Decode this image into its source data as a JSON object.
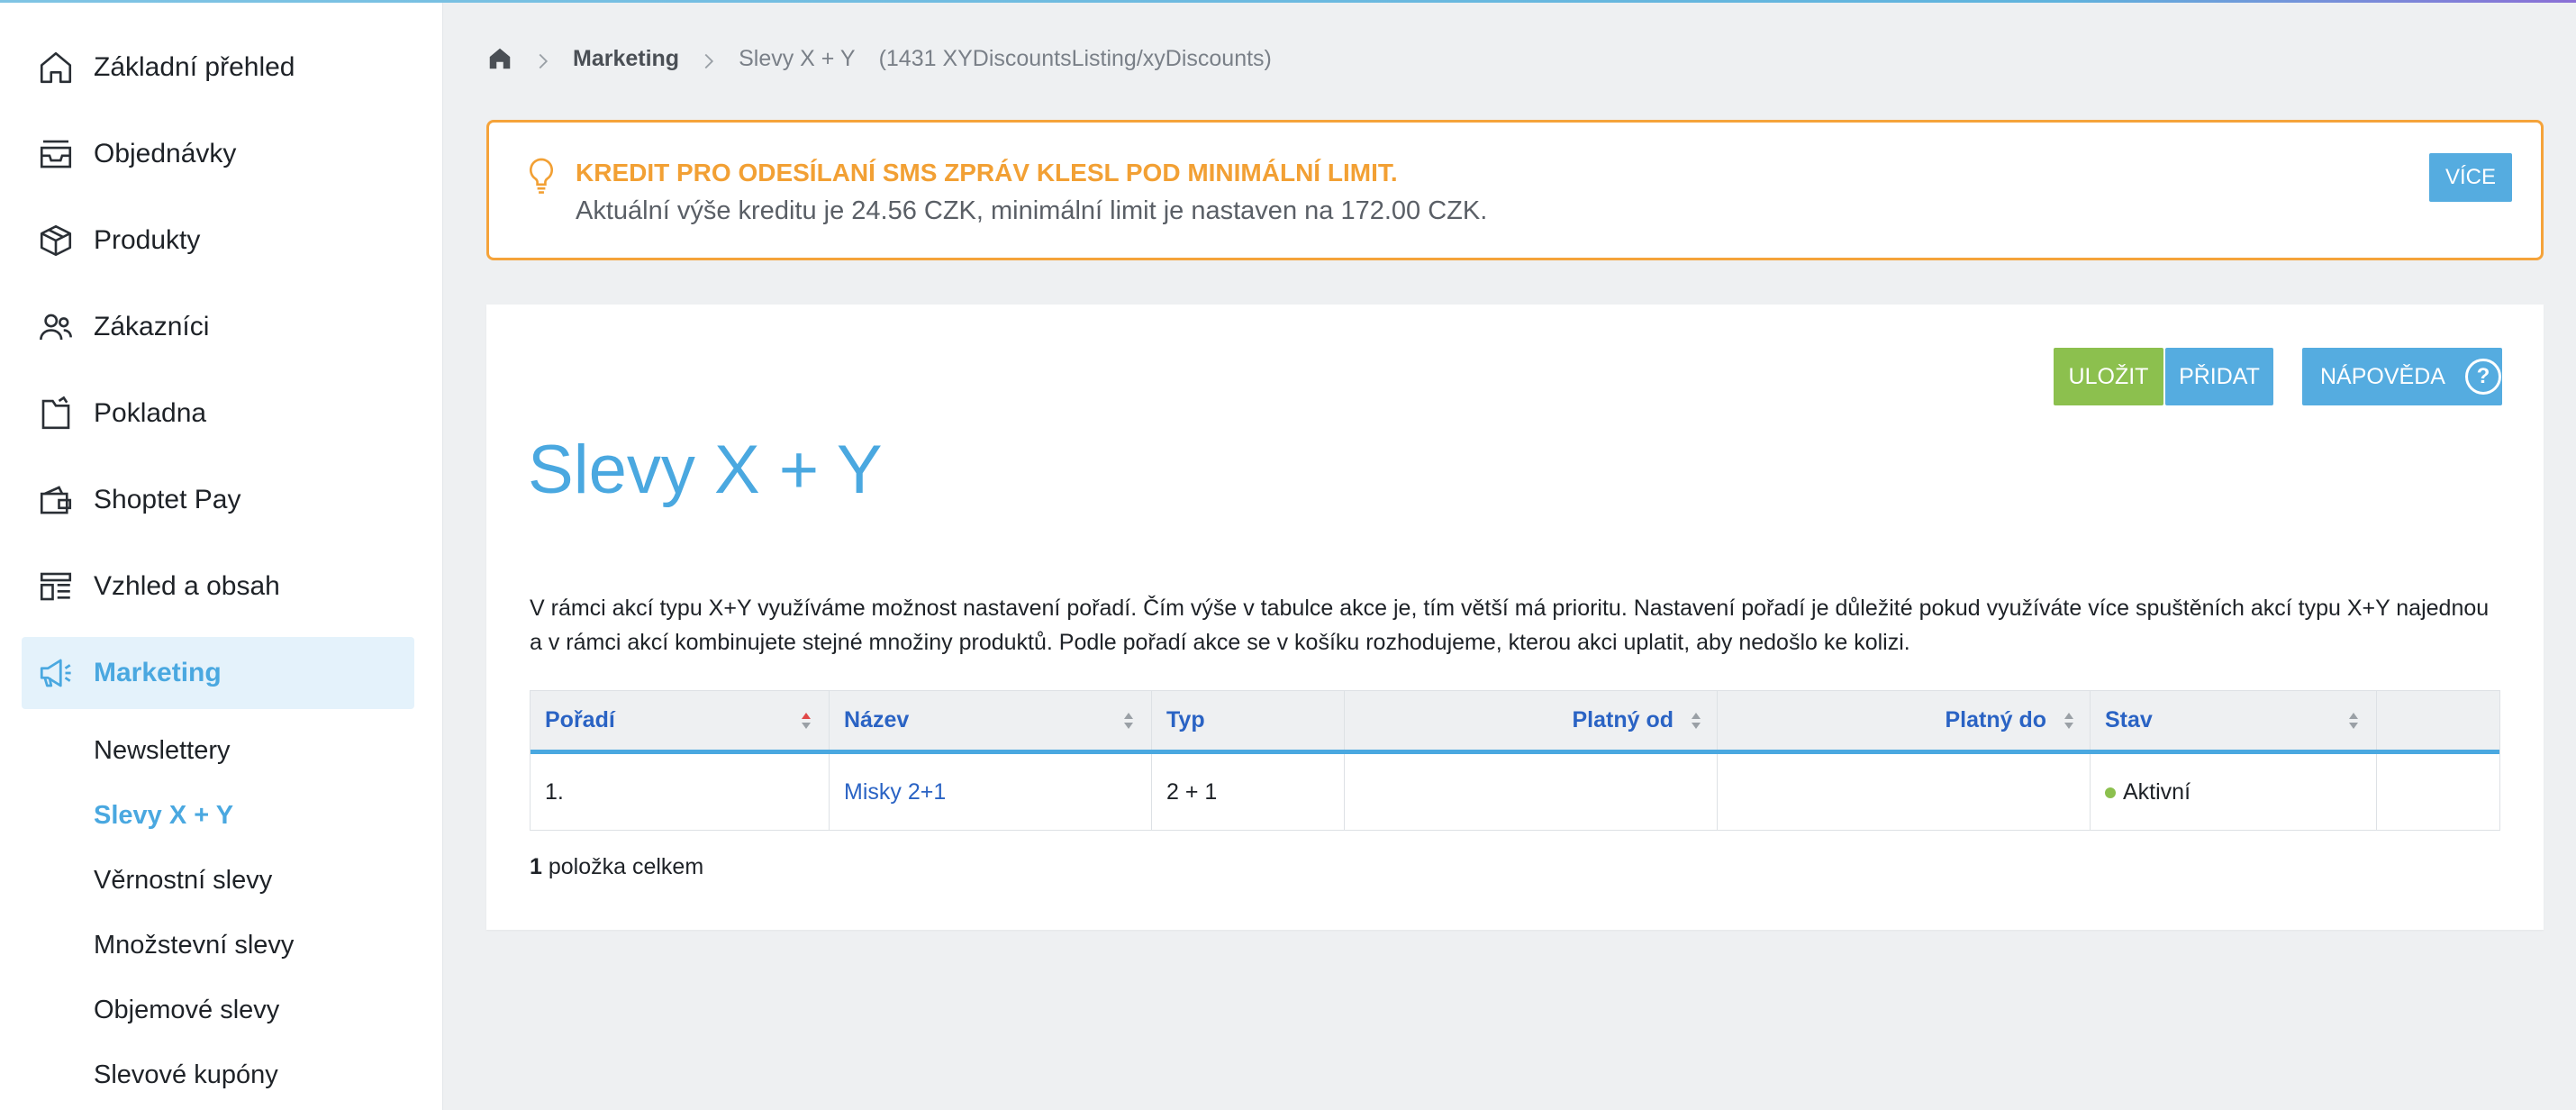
{
  "colors": {
    "accent": "#4aa8e0",
    "warning": "#f5a33a",
    "save_green": "#8cc04e",
    "link_blue": "#2a63c4"
  },
  "sidebar": {
    "items": [
      {
        "label": "Základní přehled",
        "icon": "home-icon"
      },
      {
        "label": "Objednávky",
        "icon": "inbox-icon"
      },
      {
        "label": "Produkty",
        "icon": "box-icon"
      },
      {
        "label": "Zákazníci",
        "icon": "users-icon"
      },
      {
        "label": "Pokladna",
        "icon": "cash-register-icon"
      },
      {
        "label": "Shoptet Pay",
        "icon": "wallet-icon"
      },
      {
        "label": "Vzhled a obsah",
        "icon": "layout-icon"
      },
      {
        "label": "Marketing",
        "icon": "megaphone-icon",
        "active": true
      }
    ],
    "subitems": [
      {
        "label": "Newslettery"
      },
      {
        "label": "Slevy X + Y",
        "active": true
      },
      {
        "label": "Věrnostní slevy"
      },
      {
        "label": "Množstevní slevy"
      },
      {
        "label": "Objemové slevy"
      },
      {
        "label": "Slevové kupóny"
      }
    ]
  },
  "breadcrumb": {
    "home_icon": "home-icon",
    "section": "Marketing",
    "page": "Slevy X + Y",
    "code": "(1431 XYDiscountsListing/xyDiscounts)"
  },
  "alert": {
    "icon": "lightbulb-icon",
    "title": "KREDIT PRO ODESÍLANÍ SMS ZPRÁV KLESL POD MINIMÁLNÍ LIMIT.",
    "message": "Aktuální výše kreditu je 24.56 CZK, minimální limit je nastaven na 172.00 CZK.",
    "more_label": "VÍCE"
  },
  "toolbar": {
    "save_label": "ULOŽIT",
    "add_label": "PŘIDAT",
    "help_label": "NÁPOVĚDA",
    "help_icon": "question-circle-icon"
  },
  "page_title": "Slevy X + Y",
  "description": "V rámci akcí typu X+Y využíváme možnost nastavení pořadí. Čím výše v tabulce akce je, tím větší má prioritu. Nastavení pořadí je důležité pokud využíváte více spuštěních akcí typu X+Y najednou a v rámci akcí kombinujete stejné množiny produktů. Podle pořadí akce se v košíku rozhodujeme, kterou akci uplatit, aby nedošlo ke kolizi.",
  "table": {
    "columns": [
      "Pořadí",
      "Název",
      "Typ",
      "Platný od",
      "Platný do",
      "Stav"
    ],
    "rows": [
      {
        "order": "1.",
        "name": "Misky 2+1",
        "type": "2 + 1",
        "valid_from": "",
        "valid_to": "",
        "status": "Aktivní"
      }
    ],
    "count_number": "1",
    "count_text": "položka celkem"
  }
}
